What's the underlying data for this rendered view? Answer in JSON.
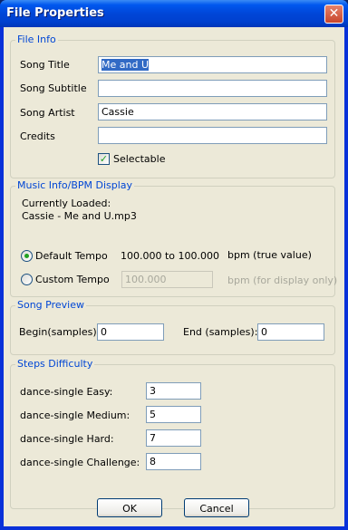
{
  "window": {
    "title": "File Properties",
    "close_glyph": "✕"
  },
  "file_info": {
    "title": "File Info",
    "fields": [
      {
        "label": "Song Title",
        "value": "Me and U"
      },
      {
        "label": "Song Subtitle",
        "value": ""
      },
      {
        "label": "Song Artist",
        "value": "Cassie"
      },
      {
        "label": "Credits",
        "value": ""
      }
    ],
    "selectable": {
      "label": "Selectable",
      "checked": true,
      "glyph": "✓"
    }
  },
  "music_info": {
    "title": "Music Info/BPM Display",
    "loaded_label": "Currently Loaded:",
    "loaded_file": "Cassie - Me and U.mp3",
    "default_tempo": {
      "label": "Default Tempo",
      "range": "100.000 to 100.000",
      "unit": "bpm (true value)",
      "selected": true
    },
    "custom_tempo": {
      "label": "Custom Tempo",
      "value": "100.000",
      "unit": "bpm (for display only)",
      "selected": false
    }
  },
  "song_preview": {
    "title": "Song Preview",
    "begin_label": "Begin(samples):",
    "begin_value": "0",
    "end_label": "End (samples):",
    "end_value": "0"
  },
  "steps_difficulty": {
    "title": "Steps Difficulty",
    "rows": [
      {
        "label": "dance-single Easy:",
        "value": "3"
      },
      {
        "label": "dance-single Medium:",
        "value": "5"
      },
      {
        "label": "dance-single Hard:",
        "value": "7"
      },
      {
        "label": "dance-single Challenge:",
        "value": "8"
      }
    ]
  },
  "buttons": {
    "ok": "OK",
    "cancel": "Cancel"
  }
}
